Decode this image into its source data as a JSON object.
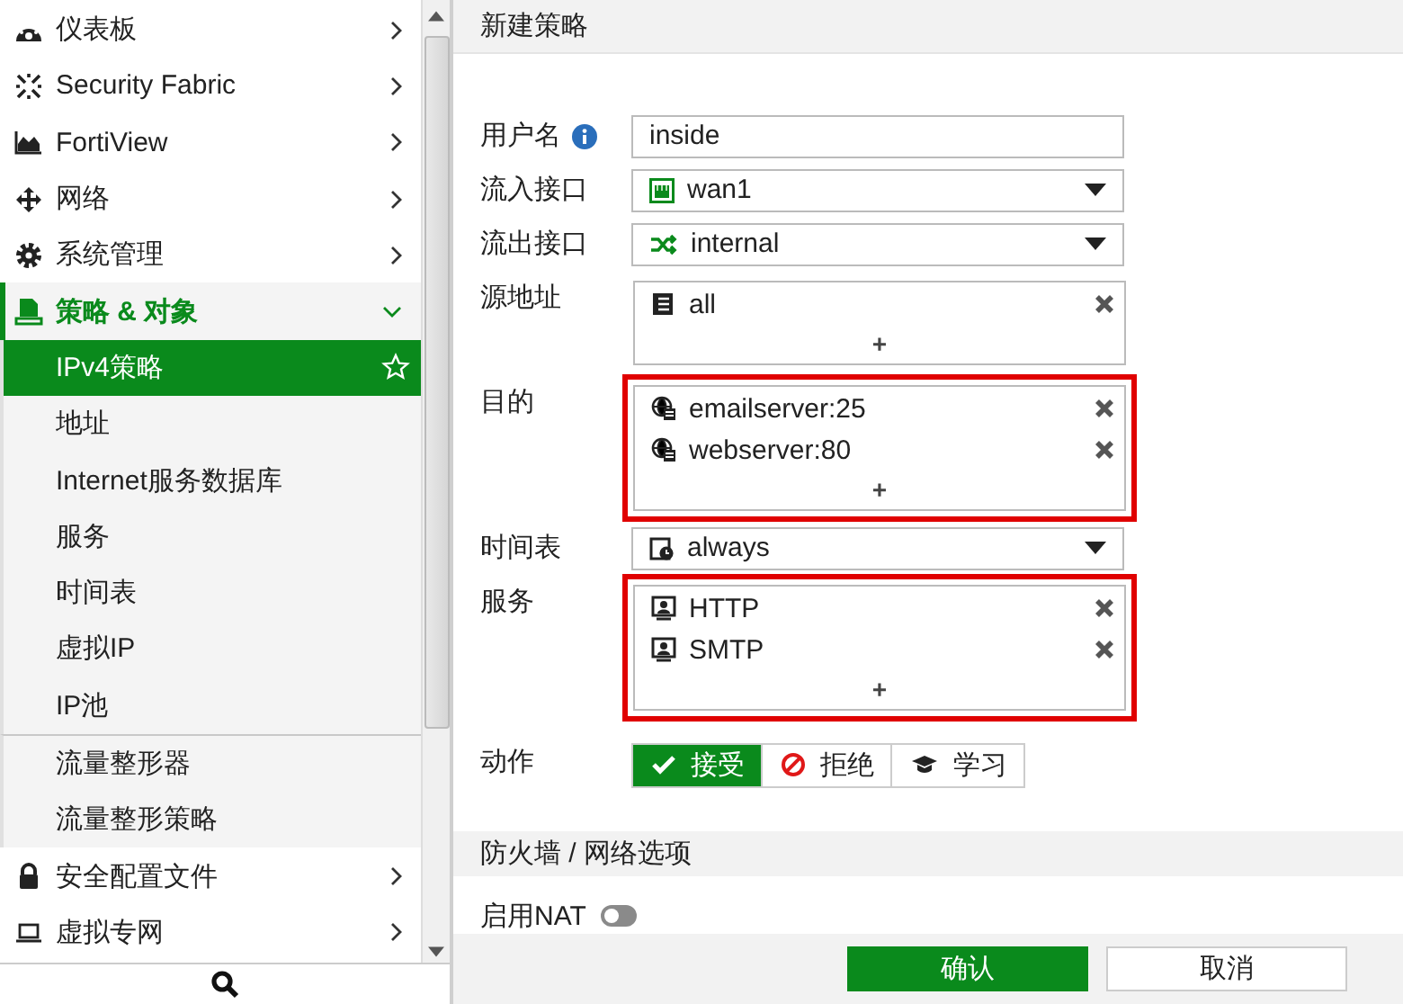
{
  "sidebar": {
    "items": [
      {
        "label": "仪表板",
        "kind": "dashboard",
        "expanded": false
      },
      {
        "label": "Security Fabric",
        "kind": "fabric",
        "expanded": false
      },
      {
        "label": "FortiView",
        "kind": "chart",
        "expanded": false
      },
      {
        "label": "网络",
        "kind": "network",
        "expanded": false
      },
      {
        "label": "系统管理",
        "kind": "gear",
        "expanded": false
      },
      {
        "label": "策略 & 对象",
        "kind": "policy",
        "expanded": true,
        "child_groups": [
          {
            "items": [
              {
                "label": "IPv4策略",
                "selected": true
              },
              {
                "label": "地址",
                "selected": false
              },
              {
                "label": "Internet服务数据库",
                "selected": false
              },
              {
                "label": "服务",
                "selected": false
              },
              {
                "label": "时间表",
                "selected": false
              },
              {
                "label": "虚拟IP",
                "selected": false
              },
              {
                "label": "IP池",
                "selected": false
              }
            ]
          },
          {
            "items": [
              {
                "label": "流量整形器",
                "selected": false
              },
              {
                "label": "流量整形策略",
                "selected": false
              }
            ]
          }
        ]
      },
      {
        "label": "安全配置文件",
        "kind": "lock",
        "expanded": false
      },
      {
        "label": "虚拟专网",
        "kind": "monitor",
        "expanded": false
      }
    ]
  },
  "header": {
    "title": "新建策略"
  },
  "form": {
    "rows": [
      {
        "label": "用户名",
        "kind": "input",
        "info": true,
        "value": "inside"
      },
      {
        "label": "流入接口",
        "kind": "select",
        "value": {
          "label": "wan1",
          "kind": "port"
        }
      },
      {
        "label": "流出接口",
        "kind": "select",
        "value": {
          "label": "internal",
          "kind": "switch"
        }
      },
      {
        "label": "源地址",
        "kind": "multi",
        "highlighted": false,
        "entries": [
          {
            "label": "all",
            "kind": "address"
          }
        ],
        "add": "+"
      },
      {
        "label": "目的",
        "kind": "multi",
        "highlighted": true,
        "entries": [
          {
            "label": "emailserver:25",
            "kind": "vip"
          },
          {
            "label": "webserver:80",
            "kind": "vip"
          }
        ],
        "add": "+"
      },
      {
        "label": "时间表",
        "kind": "select",
        "value": {
          "label": "always",
          "kind": "schedule"
        }
      },
      {
        "label": "服务",
        "kind": "multi",
        "highlighted": true,
        "entries": [
          {
            "label": "HTTP",
            "kind": "service"
          },
          {
            "label": "SMTP",
            "kind": "service"
          }
        ],
        "add": "+"
      },
      {
        "label": "动作",
        "kind": "actions",
        "options": [
          {
            "label": "接受",
            "kind": "accept",
            "selected": true
          },
          {
            "label": "拒绝",
            "kind": "deny",
            "selected": false
          },
          {
            "label": "学习",
            "kind": "learn",
            "selected": false
          }
        ]
      }
    ]
  },
  "section": {
    "title": "防火墙 / 网络选项"
  },
  "nat": {
    "label": "启用NAT",
    "on": false
  },
  "buttons": [
    {
      "label": "确认",
      "kind": "primary"
    },
    {
      "label": "取消",
      "kind": "secondary"
    }
  ]
}
